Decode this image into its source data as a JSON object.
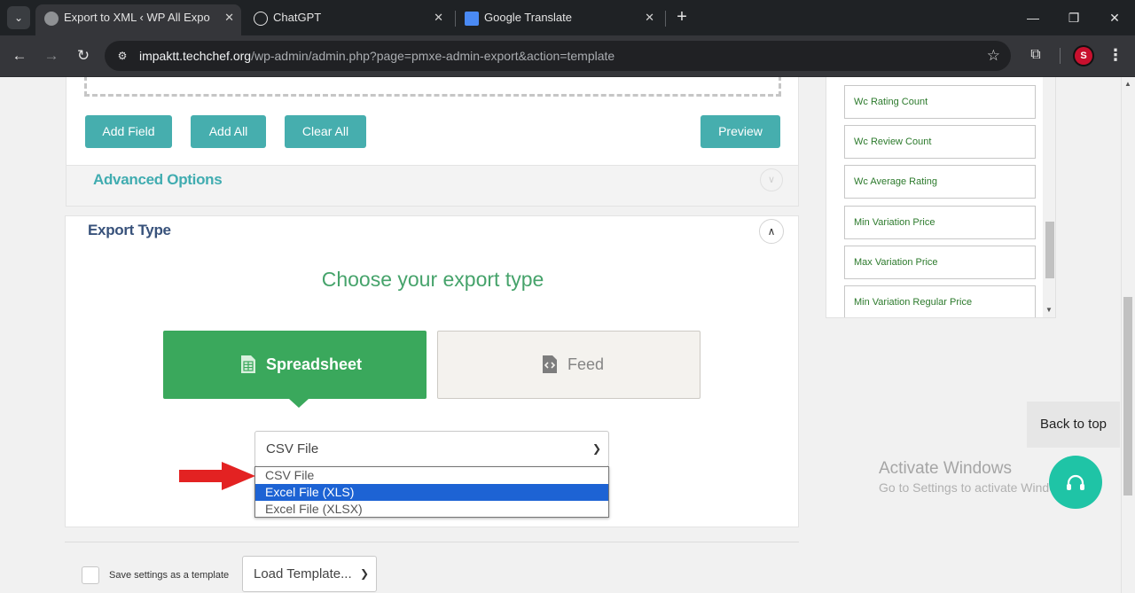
{
  "browser": {
    "tabs": [
      {
        "title": "Export to XML ‹ WP All Export ‹",
        "active": true
      },
      {
        "title": "ChatGPT",
        "active": false
      },
      {
        "title": "Google Translate",
        "active": false
      }
    ],
    "url_host": "impaktt.techchef.org",
    "url_path": "/wp-admin/admin.php?page=pmxe-admin-export&action=template",
    "profile_initial": "S"
  },
  "fields_panel": {
    "add_field": "Add Field",
    "add_all": "Add All",
    "clear_all": "Clear All",
    "preview": "Preview"
  },
  "advanced_options": {
    "title": "Advanced Options"
  },
  "export_type": {
    "title": "Export Type",
    "heading": "Choose your export type",
    "spreadsheet": "Spreadsheet",
    "feed": "Feed",
    "selected_format": "CSV File",
    "options": [
      "CSV File",
      "Excel File (XLS)",
      "Excel File (XLSX)"
    ],
    "highlighted_option": "Excel File (XLS)"
  },
  "template": {
    "save_label": "Save settings as a template",
    "load_placeholder": "Load Template..."
  },
  "field_list": [
    "Wc Rating Count",
    "Wc Review Count",
    "Wc Average Rating",
    "Min Variation Price",
    "Max Variation Price",
    "Min Variation Regular Price"
  ],
  "back_to_top": "Back to top",
  "activate_windows": {
    "title": "Activate Windows",
    "subtitle": "Go to Settings to activate Windows."
  },
  "colors": {
    "teal": "#46aeae",
    "green": "#3aa85c",
    "selection_blue": "#1d63d4",
    "help_button": "#1fc4a6",
    "arrow_red": "#e32222"
  }
}
